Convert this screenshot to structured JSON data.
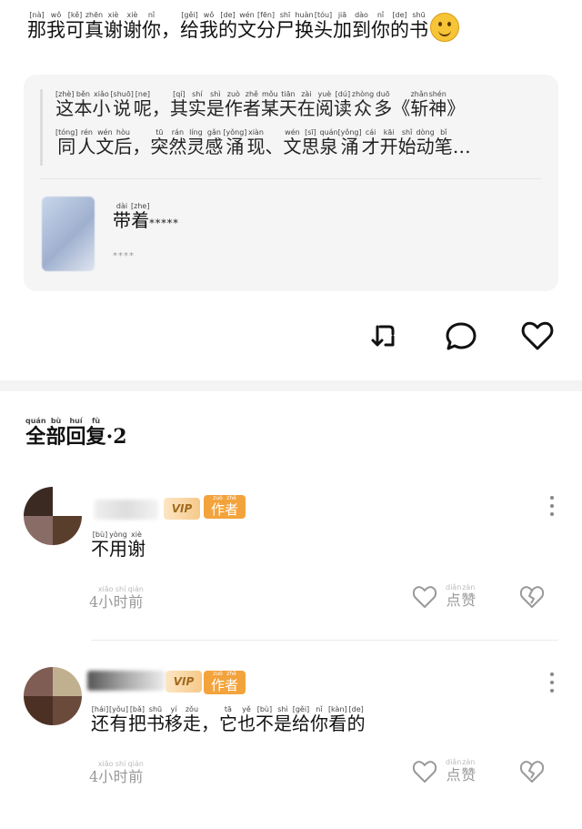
{
  "post": {
    "text_parts": [
      {
        "h": "那",
        "p": "[nà]"
      },
      {
        "h": "我",
        "p": "wǒ"
      },
      {
        "h": "可",
        "p": "[kě]"
      },
      {
        "h": "真",
        "p": "zhēn"
      },
      {
        "h": "谢",
        "p": "xiè"
      },
      {
        "h": "谢",
        "p": "xiè"
      },
      {
        "h": "你",
        "p": "nǐ"
      },
      {
        "h": "，",
        "p": ""
      },
      {
        "h": "给",
        "p": "[gěi]"
      },
      {
        "h": "我",
        "p": "wǒ"
      },
      {
        "h": "的",
        "p": "[de]"
      },
      {
        "h": "文",
        "p": "wén"
      },
      {
        "h": "分",
        "p": "[fēn]"
      },
      {
        "h": "尸",
        "p": "shī"
      },
      {
        "h": "换",
        "p": "huàn"
      },
      {
        "h": "头",
        "p": "[tóu]"
      },
      {
        "h": "加",
        "p": "jiā"
      },
      {
        "h": "到",
        "p": "dào"
      },
      {
        "h": "你",
        "p": "nǐ"
      },
      {
        "h": "的",
        "p": "[de]"
      },
      {
        "h": "书",
        "p": "shū"
      }
    ],
    "emoji": "smiling-face-emoji"
  },
  "quote_card": {
    "line1": [
      {
        "h": "这",
        "p": "[zhè]"
      },
      {
        "h": "本",
        "p": "běn"
      },
      {
        "h": "小",
        "p": "xiǎo"
      },
      {
        "h": "说",
        "p": "[shuō]"
      },
      {
        "h": "呢",
        "p": "[ne]"
      },
      {
        "h": "，",
        "p": ""
      },
      {
        "h": "其",
        "p": "[qí]"
      },
      {
        "h": "实",
        "p": "shí"
      },
      {
        "h": "是",
        "p": "shì"
      },
      {
        "h": "作",
        "p": "zuò"
      },
      {
        "h": "者",
        "p": "zhě"
      },
      {
        "h": "某",
        "p": "mǒu"
      },
      {
        "h": "天",
        "p": "tiān"
      },
      {
        "h": "在",
        "p": "zài"
      },
      {
        "h": "阅",
        "p": "yuè"
      },
      {
        "h": "读",
        "p": "[dú]"
      },
      {
        "h": "众",
        "p": "zhòng"
      },
      {
        "h": "多",
        "p": "duō"
      },
      {
        "h": "《",
        "p": ""
      },
      {
        "h": "斩",
        "p": "zhǎn"
      },
      {
        "h": "神",
        "p": "shén"
      },
      {
        "h": "》",
        "p": ""
      }
    ],
    "line2": [
      {
        "h": "同",
        "p": "[tóng]"
      },
      {
        "h": "人",
        "p": "rén"
      },
      {
        "h": "文",
        "p": "wén"
      },
      {
        "h": "后",
        "p": "hòu"
      },
      {
        "h": "，",
        "p": ""
      },
      {
        "h": "突",
        "p": "tū"
      },
      {
        "h": "然",
        "p": "rán"
      },
      {
        "h": "灵",
        "p": "líng"
      },
      {
        "h": "感",
        "p": "gǎn"
      },
      {
        "h": "涌",
        "p": "[yǒng]"
      },
      {
        "h": "现",
        "p": "xiàn"
      },
      {
        "h": "、",
        "p": ""
      },
      {
        "h": "文",
        "p": "wén"
      },
      {
        "h": "思",
        "p": "[sī]"
      },
      {
        "h": "泉",
        "p": "quán"
      },
      {
        "h": "涌",
        "p": "[yǒng]"
      },
      {
        "h": "才",
        "p": "cái"
      },
      {
        "h": "开",
        "p": "kāi"
      },
      {
        "h": "始",
        "p": "shǐ"
      },
      {
        "h": "动",
        "p": "dòng"
      },
      {
        "h": "笔",
        "p": "bǐ"
      },
      {
        "h": "…",
        "p": ""
      }
    ],
    "book_title": [
      {
        "h": "带",
        "p": "dài"
      },
      {
        "h": "着",
        "p": "[zhe]"
      }
    ],
    "book_title_stars": "*****",
    "book_subtitle": "****"
  },
  "actions": {
    "repost_icon": "repost-icon",
    "comment_icon": "comment-bubble-icon",
    "like_icon": "heart-outline-icon"
  },
  "replies": {
    "heading": [
      {
        "h": "全",
        "p": "quán"
      },
      {
        "h": "部",
        "p": "bù"
      },
      {
        "h": "回",
        "p": "huí"
      },
      {
        "h": "复",
        "p": "fù"
      }
    ],
    "count_text": "·2",
    "items": [
      {
        "badge_vip": "VIP",
        "badge_author": [
          {
            "h": "作",
            "p": "zuò"
          },
          {
            "h": "者",
            "p": "zhě"
          }
        ],
        "text": [
          {
            "h": "不",
            "p": "[bù]"
          },
          {
            "h": "用",
            "p": "yòng"
          },
          {
            "h": "谢",
            "p": "xiè"
          }
        ],
        "time": [
          {
            "h": "4",
            "p": ""
          },
          {
            "h": "小",
            "p": "xiǎo"
          },
          {
            "h": "时",
            "p": "shí"
          },
          {
            "h": "前",
            "p": "qián"
          }
        ],
        "like_label": [
          {
            "h": "点",
            "p": "diǎn"
          },
          {
            "h": "赞",
            "p": "zàn"
          }
        ]
      },
      {
        "badge_vip": "VIP",
        "badge_author": [
          {
            "h": "作",
            "p": "zuò"
          },
          {
            "h": "者",
            "p": "zhě"
          }
        ],
        "text": [
          {
            "h": "还",
            "p": "[hái]"
          },
          {
            "h": "有",
            "p": "[yǒu]"
          },
          {
            "h": "把",
            "p": "[bǎ]"
          },
          {
            "h": "书",
            "p": "shū"
          },
          {
            "h": "移",
            "p": "yí"
          },
          {
            "h": "走",
            "p": "zǒu"
          },
          {
            "h": "，",
            "p": ""
          },
          {
            "h": "它",
            "p": "tā"
          },
          {
            "h": "也",
            "p": "yě"
          },
          {
            "h": "不",
            "p": "[bù]"
          },
          {
            "h": "是",
            "p": "shì"
          },
          {
            "h": "给",
            "p": "[gěi]"
          },
          {
            "h": "你",
            "p": "nǐ"
          },
          {
            "h": "看",
            "p": "[kàn]"
          },
          {
            "h": "的",
            "p": "[de]"
          }
        ],
        "time": [
          {
            "h": "4",
            "p": ""
          },
          {
            "h": "小",
            "p": "xiǎo"
          },
          {
            "h": "时",
            "p": "shí"
          },
          {
            "h": "前",
            "p": "qián"
          }
        ],
        "like_label": [
          {
            "h": "点",
            "p": "diǎn"
          },
          {
            "h": "赞",
            "p": "zàn"
          }
        ]
      }
    ]
  },
  "colors": {
    "author_badge": "#f3a33b",
    "card_bg": "#f5f5f6",
    "muted_text": "#999999"
  }
}
